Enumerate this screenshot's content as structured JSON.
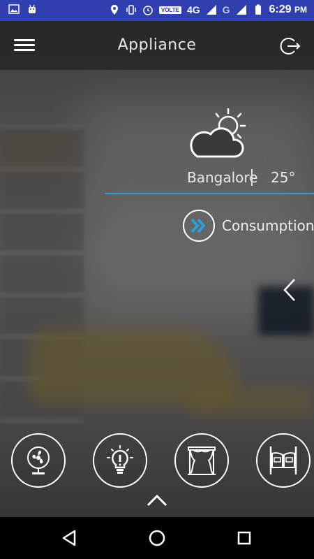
{
  "app_bar": {
    "title": "Appliance",
    "icons": [
      "menu-icon",
      "logout-icon"
    ]
  },
  "status_bar": {
    "network": "4G",
    "volte": "VOLTE",
    "carrier_badge": "G",
    "time": "6:29",
    "am_pm": "PM"
  },
  "weather": {
    "icon": "partly-cloudy-icon",
    "city": "Bangalore",
    "temperature": "25°"
  },
  "consumptions": {
    "label": "Consumptions",
    "icon": "double-chevron-right-icon"
  },
  "appliances": [
    {
      "name": "fan",
      "icon": "fan-icon"
    },
    {
      "name": "light",
      "icon": "bulb-icon"
    },
    {
      "name": "curtain",
      "icon": "curtain-icon"
    },
    {
      "name": "door",
      "icon": "saloon-door-icon"
    }
  ],
  "colors": {
    "status_bar": "#2f3faf",
    "accent_line": "#2aa0d8",
    "consumption_icon": "#2aa0d8"
  }
}
